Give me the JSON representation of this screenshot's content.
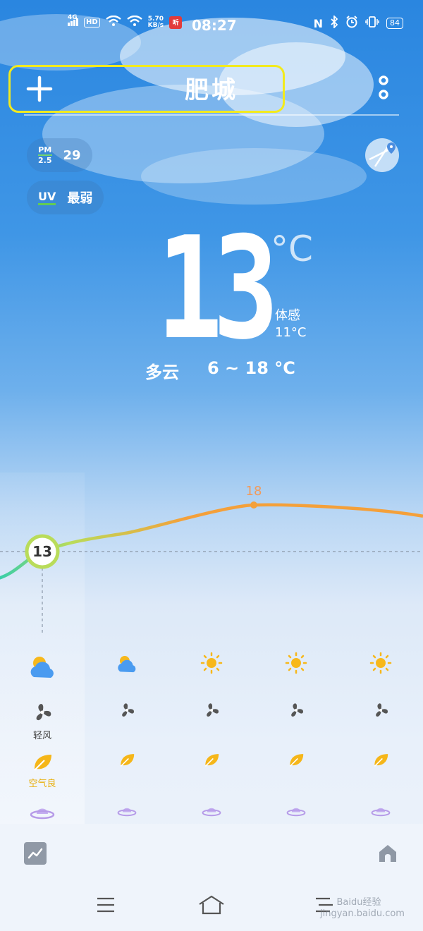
{
  "status_bar": {
    "network": "4G",
    "hd": "HD",
    "speed_value": "5.70",
    "speed_unit": "KB/s",
    "app_badge": "听",
    "time": "08:27",
    "battery": "84"
  },
  "header": {
    "city": "肥城",
    "add_icon": "plus-icon",
    "more_icon": "more-vertical-icon"
  },
  "badges": {
    "pm_label_top": "PM",
    "pm_label_bottom": "2.5",
    "pm_value": "29",
    "uv_label": "UV",
    "uv_value": "最弱"
  },
  "current": {
    "temperature": "13",
    "unit": "°C",
    "feels_label": "体感",
    "feels_value": "11°C",
    "condition": "多云",
    "range": "6 ~ 18 °C"
  },
  "chart_data": {
    "type": "line",
    "x": [
      0,
      1,
      2,
      3,
      4
    ],
    "values": [
      13,
      15,
      17,
      18,
      17
    ],
    "labels": {
      "current": "13",
      "max": "18"
    },
    "max_index": 3,
    "colors": {
      "start": "#2ccdb0",
      "mid": "#b9dc5a",
      "end": "#f4a03a",
      "max_label": "#f29a5a"
    }
  },
  "forecast": {
    "weather_icons": [
      "partly-cloudy-icon",
      "partly-cloudy-icon",
      "sun-icon",
      "sun-icon",
      "sun-icon"
    ],
    "wind_icons": [
      "fan-icon",
      "fan-icon",
      "fan-icon",
      "fan-icon",
      "fan-icon"
    ],
    "wind_label": "轻风",
    "air_icons": [
      "leaf-icon",
      "leaf-icon",
      "leaf-icon",
      "leaf-icon",
      "leaf-icon"
    ],
    "air_label": "空气良",
    "hat_icons": [
      "hat-icon",
      "hat-icon",
      "hat-icon",
      "hat-icon",
      "hat-icon"
    ]
  },
  "bottom_bar": {
    "left_icon": "trend-chart-icon",
    "right_icon": "home-icon"
  },
  "nav_bar": {
    "menu_icon": "menu-icon",
    "home_icon": "home-nav-icon",
    "back_icon": "back-icon"
  },
  "watermark": "Baidu经验 jingyan.baidu.com",
  "colors": {
    "sky_top": "#2a86e0",
    "highlight_box": "#f2ea1e",
    "sun": "#f7b81b",
    "hat": "#b69be8"
  }
}
